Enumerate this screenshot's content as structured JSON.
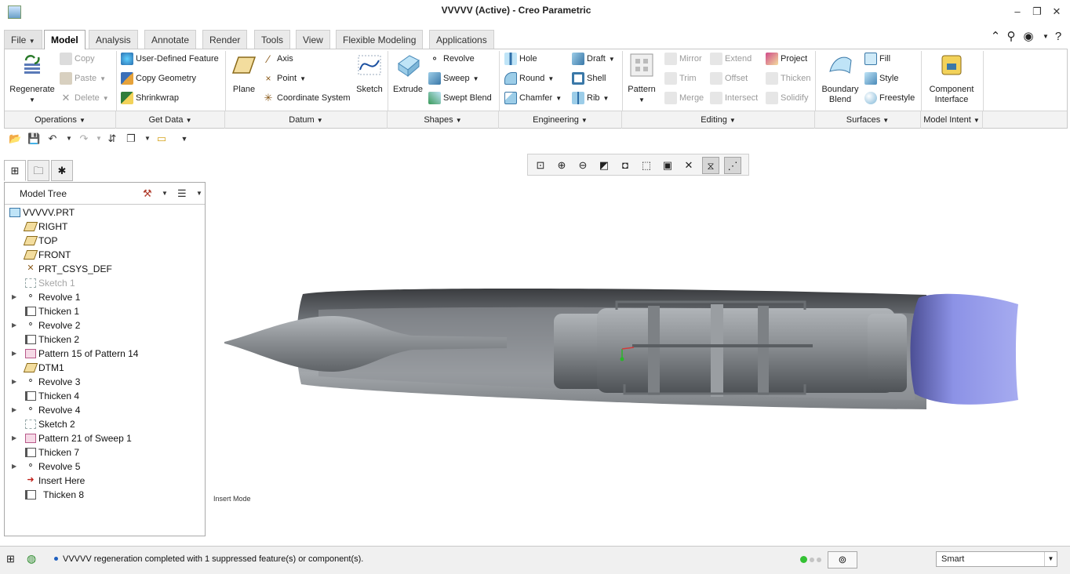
{
  "window": {
    "title": "VVVVV (Active) - Creo Parametric",
    "minimize": "–",
    "restore": "❐",
    "close": "✕"
  },
  "tabs": [
    "File",
    "Model",
    "Analysis",
    "Annotate",
    "Render",
    "Tools",
    "View",
    "Flexible Modeling",
    "Applications"
  ],
  "active_tab": "Model",
  "ribbon": {
    "operations": {
      "regenerate": "Regenerate",
      "copy": "Copy",
      "paste": "Paste",
      "delete": "Delete"
    },
    "get_data": {
      "user_defined_feature": "User-Defined Feature",
      "copy_geometry": "Copy Geometry",
      "shrinkwrap": "Shrinkwrap"
    },
    "datum": {
      "plane": "Plane",
      "axis": "Axis",
      "point": "Point",
      "coordinate_system": "Coordinate System",
      "sketch": "Sketch"
    },
    "shapes": {
      "extrude": "Extrude",
      "revolve": "Revolve",
      "sweep": "Sweep",
      "swept_blend": "Swept Blend"
    },
    "engineering": {
      "hole": "Hole",
      "round": "Round",
      "chamfer": "Chamfer",
      "draft": "Draft",
      "shell": "Shell",
      "rib": "Rib"
    },
    "editing": {
      "pattern": "Pattern",
      "mirror": "Mirror",
      "trim": "Trim",
      "merge": "Merge",
      "extend": "Extend",
      "offset": "Offset",
      "intersect": "Intersect",
      "project": "Project",
      "thicken": "Thicken",
      "solidify": "Solidify"
    },
    "surfaces": {
      "boundary_blend_1": "Boundary",
      "boundary_blend_2": "Blend",
      "fill": "Fill",
      "style": "Style",
      "freestyle": "Freestyle"
    },
    "model_intent": {
      "component_1": "Component",
      "component_2": "Interface"
    },
    "group_labels": {
      "operations": "Operations",
      "get_data": "Get Data",
      "datum": "Datum",
      "shapes": "Shapes",
      "engineering": "Engineering",
      "editing": "Editing",
      "surfaces": "Surfaces",
      "model_intent": "Model Intent"
    }
  },
  "model_tree": {
    "title": "Model Tree",
    "items": [
      {
        "label": "VVVVV.PRT",
        "icon": "part-icon",
        "expandable": false,
        "indent": 0
      },
      {
        "label": "RIGHT",
        "icon": "datum-plane-icon",
        "expandable": false,
        "indent": 1
      },
      {
        "label": "TOP",
        "icon": "datum-plane-icon",
        "expandable": false,
        "indent": 1
      },
      {
        "label": "FRONT",
        "icon": "datum-plane-icon",
        "expandable": false,
        "indent": 1
      },
      {
        "label": "PRT_CSYS_DEF",
        "icon": "csys-icon",
        "expandable": false,
        "indent": 1
      },
      {
        "label": "Sketch 1",
        "icon": "sketch-icon",
        "expandable": false,
        "indent": 1,
        "suppressed": true
      },
      {
        "label": "Revolve 1",
        "icon": "revolve-icon",
        "expandable": true,
        "indent": 1
      },
      {
        "label": "Thicken 1",
        "icon": "thicken-icon",
        "expandable": false,
        "indent": 1
      },
      {
        "label": "Revolve 2",
        "icon": "revolve-icon",
        "expandable": true,
        "indent": 1
      },
      {
        "label": "Thicken 2",
        "icon": "thicken-icon",
        "expandable": false,
        "indent": 1
      },
      {
        "label": "Pattern 15 of Pattern 14",
        "icon": "pattern-icon",
        "expandable": true,
        "indent": 1
      },
      {
        "label": "DTM1",
        "icon": "datum-plane-icon",
        "expandable": false,
        "indent": 1
      },
      {
        "label": "Revolve 3",
        "icon": "revolve-icon",
        "expandable": true,
        "indent": 1
      },
      {
        "label": "Thicken 4",
        "icon": "thicken-icon",
        "expandable": false,
        "indent": 1
      },
      {
        "label": "Revolve 4",
        "icon": "revolve-icon",
        "expandable": true,
        "indent": 1
      },
      {
        "label": "Sketch 2",
        "icon": "sketch-icon",
        "expandable": false,
        "indent": 1
      },
      {
        "label": "Pattern 21 of Sweep 1",
        "icon": "pattern-icon",
        "expandable": true,
        "indent": 1
      },
      {
        "label": "Thicken 7",
        "icon": "thicken-icon",
        "expandable": false,
        "indent": 1
      },
      {
        "label": "Revolve 5",
        "icon": "revolve-icon",
        "expandable": true,
        "indent": 1
      },
      {
        "label": "Insert Here",
        "icon": "insert-arrow-icon",
        "expandable": false,
        "indent": 1
      },
      {
        "label": "Thicken 8",
        "icon": "thicken-icon",
        "expandable": false,
        "indent": 1
      }
    ]
  },
  "graphics": {
    "mode_label": "Insert Mode"
  },
  "status": {
    "message": "VVVVV regeneration completed with 1 suppressed feature(s) or component(s).",
    "filter_value": "Smart"
  },
  "colors": {
    "ribbon_bg": "#ffffff",
    "accent": "#1f5fbf",
    "model_shell": "#8d9296",
    "nozzle_blue": "#7f86e0"
  }
}
